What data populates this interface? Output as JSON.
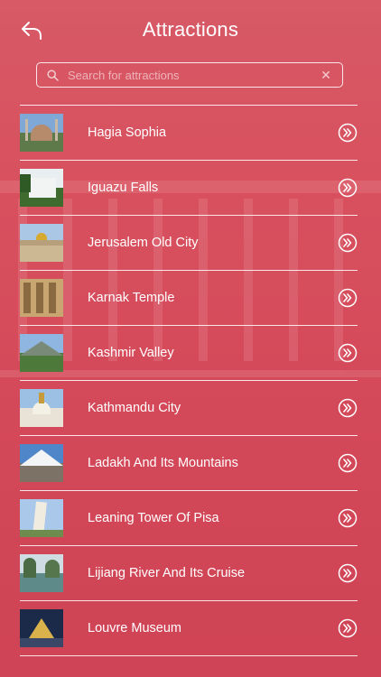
{
  "header": {
    "title": "Attractions",
    "back_icon": "back-arrow-icon"
  },
  "search": {
    "placeholder": "Search for attractions",
    "value": ""
  },
  "attractions": [
    {
      "name": "Hagia Sophia"
    },
    {
      "name": "Iguazu Falls"
    },
    {
      "name": "Jerusalem Old City"
    },
    {
      "name": "Karnak Temple"
    },
    {
      "name": "Kashmir Valley"
    },
    {
      "name": "Kathmandu City"
    },
    {
      "name": "Ladakh And Its Mountains"
    },
    {
      "name": "Leaning Tower Of Pisa"
    },
    {
      "name": "Lijiang River And Its Cruise"
    },
    {
      "name": "Louvre Museum"
    }
  ],
  "colors": {
    "background": "#d54a5a",
    "text": "#ffffff"
  }
}
